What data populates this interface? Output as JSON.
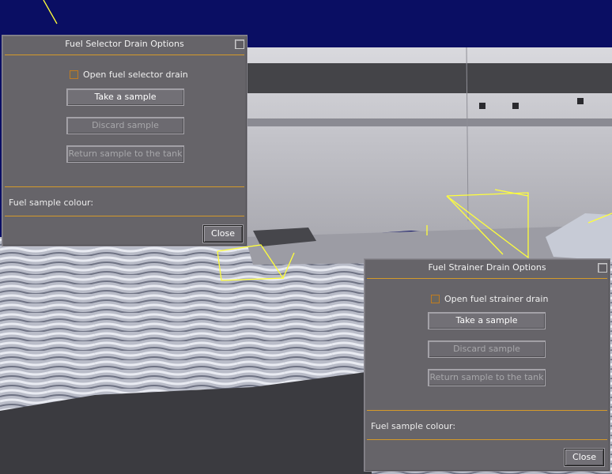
{
  "selector_dialog": {
    "title": "Fuel Selector Drain Options",
    "checkbox_label": "Open fuel selector drain",
    "take_sample": "Take a sample",
    "discard_sample": "Discard sample",
    "return_sample": "Return sample to the tank",
    "colour_label": "Fuel sample colour:",
    "close": "Close"
  },
  "strainer_dialog": {
    "title": "Fuel Strainer Drain Options",
    "checkbox_label": "Open fuel strainer drain",
    "take_sample": "Take a sample",
    "discard_sample": "Discard sample",
    "return_sample": "Return sample to the tank",
    "colour_label": "Fuel sample colour:",
    "close": "Close"
  },
  "colors": {
    "dialog_bg": "#666469",
    "separator": "#d49a2a",
    "guide_lines": "#ffff3a",
    "sky": "#0a0e63",
    "water": "#c8ccd6"
  }
}
